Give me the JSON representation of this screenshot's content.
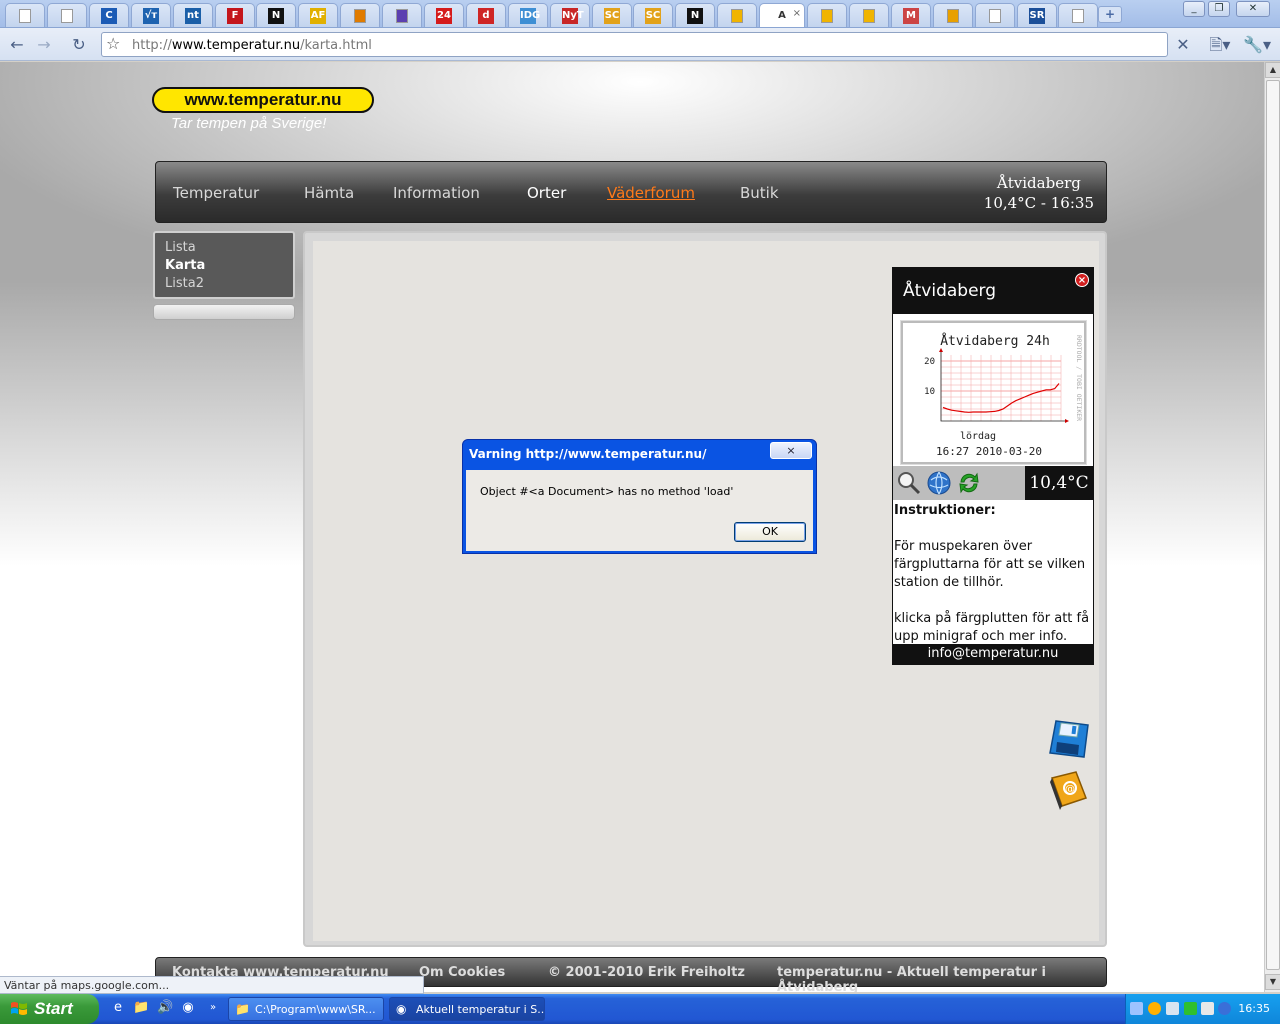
{
  "browser": {
    "tabs": [
      {
        "label": ""
      },
      {
        "label": ""
      },
      {
        "label": "C"
      },
      {
        "label": "√т"
      },
      {
        "label": "nt"
      },
      {
        "label": "F"
      },
      {
        "label": "N"
      },
      {
        "label": "AF"
      },
      {
        "label": ""
      },
      {
        "label": ""
      },
      {
        "label": "24"
      },
      {
        "label": "d"
      },
      {
        "label": "IDG"
      },
      {
        "label": "NyT"
      },
      {
        "label": "SC"
      },
      {
        "label": "SC"
      },
      {
        "label": "N"
      },
      {
        "label": ""
      },
      {
        "label": "A"
      },
      {
        "label": ""
      },
      {
        "label": ""
      },
      {
        "label": "M"
      },
      {
        "label": ""
      },
      {
        "label": ""
      },
      {
        "label": "SR"
      },
      {
        "label": ""
      }
    ],
    "new_tab": "+",
    "url_prefix": "http://",
    "url_host": "www.temperatur.nu",
    "url_path": "/karta.html",
    "status_text": "Väntar på maps.google.com..."
  },
  "site": {
    "logo": "www.temperatur.nu",
    "tagline": "Tar tempen på Sverige!",
    "nav": [
      {
        "label": "Temperatur",
        "state": "normal"
      },
      {
        "label": "Hämta",
        "state": "normal"
      },
      {
        "label": "Information",
        "state": "normal"
      },
      {
        "label": "Orter",
        "state": "current"
      },
      {
        "label": "Väderforum",
        "state": "hot"
      },
      {
        "label": "Butik",
        "state": "normal"
      }
    ],
    "station_name": "Åtvidaberg",
    "station_reading": "10,4°C - 16:35",
    "submenu": [
      "Lista",
      "Karta",
      "Lista2"
    ],
    "submenu_selected": 1,
    "footer": [
      "Kontakta www.temperatur.nu",
      "Om Cookies",
      "© 2001-2010 Erik Freiholtz",
      "temperatur.nu - Aktuell temperatur i Åtvidaberg"
    ]
  },
  "panel": {
    "title": "Åtvidaberg",
    "close_symbol": "×",
    "current_temp": "10,4°C",
    "instructions_title": "Instruktioner:",
    "instructions_1": "För muspekaren över färgpluttarna för att se vilken station de tillhör.",
    "instructions_2": "klicka på färgplutten för att få upp minigraf och mer info.",
    "email": "info@temperatur.nu"
  },
  "chart_data": {
    "type": "line",
    "title": "Åtvidaberg 24h",
    "xlabel": "lördag",
    "footer": "16:27  2010-03-20",
    "side_label": "RRDTOOL / TOBI OETIKER",
    "ylim": [
      0,
      22
    ],
    "yticks": [
      10,
      20
    ],
    "series": [
      {
        "values": [
          4.5,
          4.0,
          3.6,
          3.4,
          3.2,
          3.0,
          2.9,
          3.0,
          3.0,
          3.0,
          3.0,
          3.1,
          3.2,
          3.5,
          4.0,
          5.0,
          6.0,
          6.8,
          7.4,
          8.0,
          8.6,
          9.2,
          9.6,
          10.0,
          10.4,
          10.4,
          10.8,
          12.5
        ]
      }
    ],
    "grid": true,
    "line_color": "#e00000",
    "grid_color": "#f4a6a6"
  },
  "dialog": {
    "title": "Varning http://www.temperatur.nu/",
    "message": "Object #<a Document> has no method 'load'",
    "ok_label": "OK",
    "close_symbol": "×"
  },
  "taskbar": {
    "start_label": "Start",
    "tasks": [
      {
        "label": "C:\\Program\\www\\SR..."
      },
      {
        "label": "Aktuell temperatur i S..."
      }
    ],
    "clock": "16:35"
  }
}
